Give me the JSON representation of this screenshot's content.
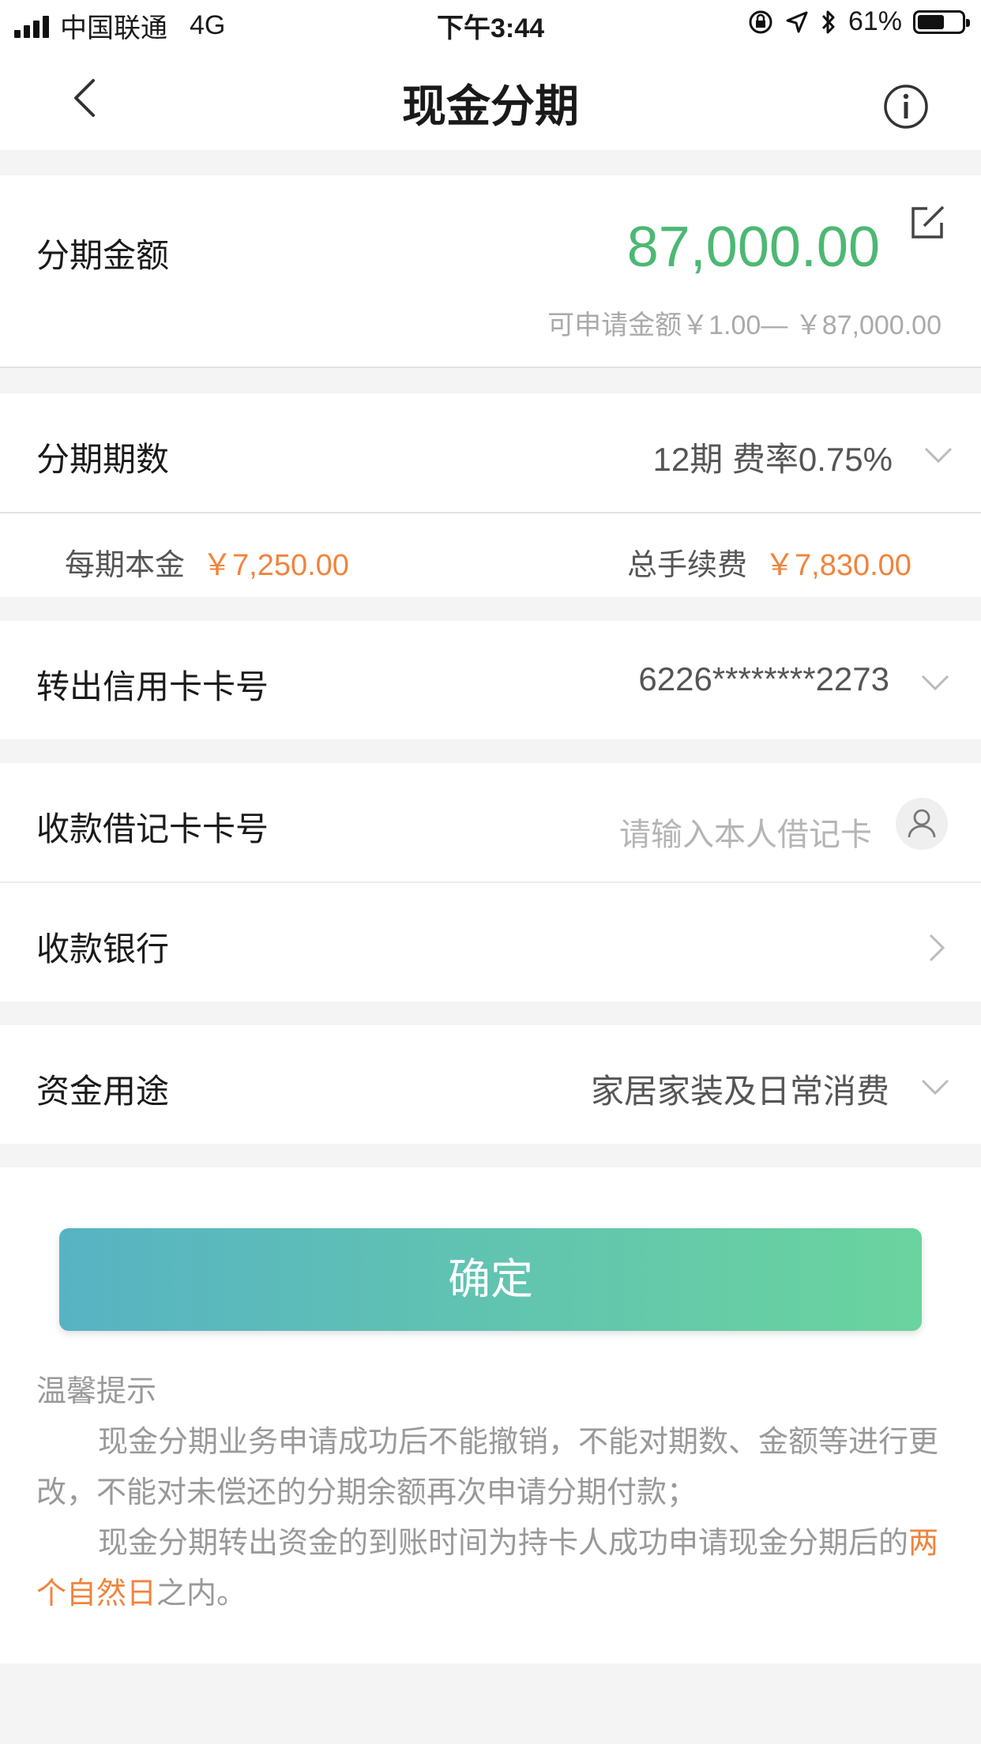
{
  "status_bar": {
    "carrier": "中国联通",
    "network": "4G",
    "time": "下午3:44",
    "battery": "61%",
    "battery_level": 0.61
  },
  "nav": {
    "title": "现金分期",
    "back_icon": "chevron-left-icon",
    "info_icon": "info-icon"
  },
  "amount_section": {
    "label": "分期金额",
    "amount": "87,000.00",
    "range": "可申请金额￥1.00— ￥87,000.00",
    "edit_icon": "edit-icon"
  },
  "term_section": {
    "label": "分期期数",
    "value": "12期 费率0.75%",
    "principal_label": "每期本金",
    "principal_value": "￥7,250.00",
    "fee_label": "总手续费",
    "fee_value": "￥7,830.00"
  },
  "card_section": {
    "label": "转出信用卡卡号",
    "value": "6226********2273"
  },
  "debit_section": {
    "label": "收款借记卡卡号",
    "placeholder": "请输入本人借记卡",
    "user_icon": "user-icon"
  },
  "bank_section": {
    "label": "收款银行"
  },
  "purpose_section": {
    "label": "资金用途",
    "value": "家居家装及日常消费"
  },
  "confirm_button": "确定",
  "notice": {
    "title": "温馨提示",
    "line1": "现金分期业务申请成功后不能撤销，不能对期数、金额等进行更改，不能对未偿还的分期余额再次申请分期付款；",
    "line2_prefix": "现金分期转出资金的到账时间为持卡人成功申请现金分期后的",
    "line2_highlight": "两个自然日",
    "line2_suffix": "之内。"
  },
  "colors": {
    "amount_green": "#4cb873",
    "highlight_orange": "#f0843c",
    "button_start": "#57b3c3",
    "button_end": "#6ad49e"
  }
}
